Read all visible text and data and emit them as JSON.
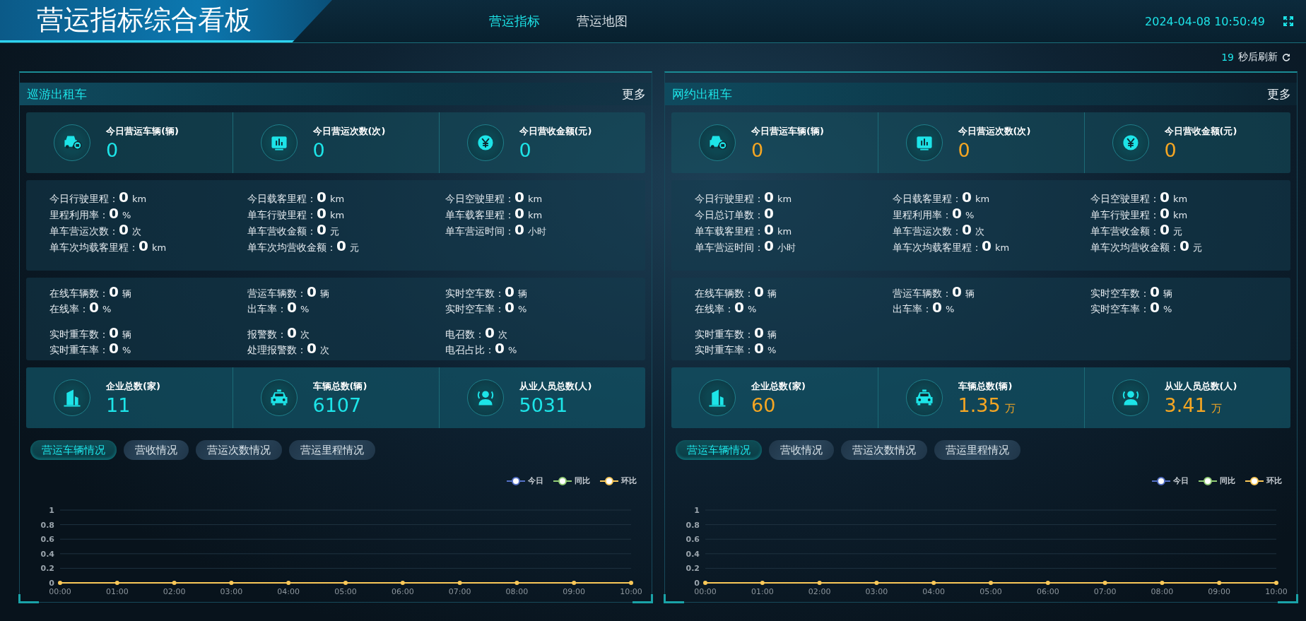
{
  "header": {
    "title": "营运指标综合看板",
    "nav": [
      {
        "label": "营运指标",
        "selected": true
      },
      {
        "label": "营运地图",
        "selected": false
      }
    ],
    "datetime": "2024-04-08 10:50:49"
  },
  "refresh": {
    "count": "19",
    "label": "秒后刷新"
  },
  "panels": [
    {
      "title": "巡游出租车",
      "more": "更多",
      "color": "#1de4e8",
      "kpis": [
        {
          "label": "今日营运车辆(辆)",
          "value": "0"
        },
        {
          "label": "今日营运次数(次)",
          "value": "0"
        },
        {
          "label": "今日营收金额(元)",
          "value": "0"
        }
      ],
      "mileage": [
        {
          "label": "今日行驶里程：",
          "value": "0",
          "unit": "km"
        },
        {
          "label": "今日载客里程：",
          "value": "0",
          "unit": "km"
        },
        {
          "label": "今日空驶里程：",
          "value": "0",
          "unit": "km"
        },
        {
          "label": "里程利用率：",
          "value": "0",
          "unit": "%"
        },
        {
          "label": "单车行驶里程：",
          "value": "0",
          "unit": "km"
        },
        {
          "label": "单车载客里程：",
          "value": "0",
          "unit": "km"
        },
        {
          "label": "单车营运次数：",
          "value": "0",
          "unit": "次"
        },
        {
          "label": "单车营收金额：",
          "value": "0",
          "unit": "元"
        },
        {
          "label": "单车营运时间：",
          "value": "0",
          "unit": "小时"
        },
        {
          "label": "单车次均载客里程：",
          "value": "0",
          "unit": "km"
        },
        {
          "label": "单车次均营收金额：",
          "value": "0",
          "unit": "元"
        }
      ],
      "realtime": [
        [
          [
            {
              "label": "在线车辆数：",
              "value": "0",
              "unit": "辆"
            },
            {
              "label": "在线率：",
              "value": "0",
              "unit": "%"
            }
          ],
          [
            {
              "label": "营运车辆数：",
              "value": "0",
              "unit": "辆"
            },
            {
              "label": "出车率：",
              "value": "0",
              "unit": "%"
            }
          ],
          [
            {
              "label": "实时空车数：",
              "value": "0",
              "unit": "辆"
            },
            {
              "label": "实时空车率：",
              "value": "0",
              "unit": "%"
            }
          ]
        ],
        [
          [
            {
              "label": "实时重车数：",
              "value": "0",
              "unit": "辆"
            },
            {
              "label": "实时重车率：",
              "value": "0",
              "unit": "%"
            }
          ],
          [
            {
              "label": "报警数：",
              "value": "0",
              "unit": "次"
            },
            {
              "label": "处理报警数：",
              "value": "0",
              "unit": "次"
            }
          ],
          [
            {
              "label": "电召数：",
              "value": "0",
              "unit": "次"
            },
            {
              "label": "电召占比：",
              "value": "0",
              "unit": "%"
            }
          ]
        ]
      ],
      "totals": [
        {
          "label": "企业总数(家)",
          "value": "11"
        },
        {
          "label": "车辆总数(辆)",
          "value": "6107"
        },
        {
          "label": "从业人员总数(人)",
          "value": "5031"
        }
      ],
      "tabs": [
        {
          "label": "营运车辆情况",
          "selected": true
        },
        {
          "label": "营收情况",
          "selected": false
        },
        {
          "label": "营运次数情况",
          "selected": false
        },
        {
          "label": "营运里程情况",
          "selected": false
        }
      ],
      "chart_data": {
        "type": "line",
        "grid": true,
        "categories": [
          "00:00",
          "01:00",
          "02:00",
          "03:00",
          "04:00",
          "05:00",
          "06:00",
          "07:00",
          "08:00",
          "09:00",
          "10:00"
        ],
        "ylim": [
          0,
          1
        ],
        "yticks": [
          0,
          0.2,
          0.4,
          0.6,
          0.8,
          1
        ],
        "series": [
          {
            "name": "今日",
            "color": "#5470c6",
            "values": [
              null,
              null,
              null,
              null,
              null,
              null,
              null,
              null,
              null,
              null,
              null
            ]
          },
          {
            "name": "同比",
            "color": "#91cc75",
            "values": [
              null,
              null,
              null,
              null,
              null,
              null,
              null,
              null,
              null,
              null,
              null
            ]
          },
          {
            "name": "环比",
            "color": "#fac858",
            "marker": true,
            "values": [
              0,
              0,
              0,
              0,
              0,
              0,
              0,
              0,
              0,
              0,
              0
            ]
          }
        ]
      }
    },
    {
      "title": "网约出租车",
      "more": "更多",
      "color": "#f5a623",
      "kpis": [
        {
          "label": "今日营运车辆(辆)",
          "value": "0"
        },
        {
          "label": "今日营运次数(次)",
          "value": "0"
        },
        {
          "label": "今日营收金额(元)",
          "value": "0"
        }
      ],
      "mileage": [
        {
          "label": "今日行驶里程：",
          "value": "0",
          "unit": "km"
        },
        {
          "label": "今日载客里程：",
          "value": "0",
          "unit": "km"
        },
        {
          "label": "今日空驶里程：",
          "value": "0",
          "unit": "km"
        },
        {
          "label": "今日总订单数：",
          "value": "0"
        },
        {
          "label": "里程利用率：",
          "value": "0",
          "unit": "%"
        },
        {
          "label": "单车行驶里程：",
          "value": "0",
          "unit": "km"
        },
        {
          "label": "单车载客里程：",
          "value": "0",
          "unit": "km"
        },
        {
          "label": "单车营运次数：",
          "value": "0",
          "unit": "次"
        },
        {
          "label": "单车营收金额：",
          "value": "0",
          "unit": "元"
        },
        {
          "label": "单车营运时间：",
          "value": "0",
          "unit": "小时"
        },
        {
          "label": "单车次均载客里程：",
          "value": "0",
          "unit": "km"
        },
        {
          "label": "单车次均营收金额：",
          "value": "0",
          "unit": "元"
        }
      ],
      "realtime": [
        [
          [
            {
              "label": "在线车辆数：",
              "value": "0",
              "unit": "辆"
            },
            {
              "label": "在线率：",
              "value": "0",
              "unit": "%"
            }
          ],
          [
            {
              "label": "营运车辆数：",
              "value": "0",
              "unit": "辆"
            },
            {
              "label": "出车率：",
              "value": "0",
              "unit": "%"
            }
          ],
          [
            {
              "label": "实时空车数：",
              "value": "0",
              "unit": "辆"
            },
            {
              "label": "实时空车率：",
              "value": "0",
              "unit": "%"
            }
          ]
        ],
        [
          [
            {
              "label": "实时重车数：",
              "value": "0",
              "unit": "辆"
            },
            {
              "label": "实时重车率：",
              "value": "0",
              "unit": "%"
            }
          ]
        ]
      ],
      "totals": [
        {
          "label": "企业总数(家)",
          "value": "60"
        },
        {
          "label": "车辆总数(辆)",
          "value": "1.35",
          "unit": "万"
        },
        {
          "label": "从业人员总数(人)",
          "value": "3.41",
          "unit": "万"
        }
      ],
      "tabs": [
        {
          "label": "营运车辆情况",
          "selected": true
        },
        {
          "label": "营收情况",
          "selected": false
        },
        {
          "label": "营运次数情况",
          "selected": false
        },
        {
          "label": "营运里程情况",
          "selected": false
        }
      ],
      "chart_data": {
        "type": "line",
        "grid": true,
        "categories": [
          "00:00",
          "01:00",
          "02:00",
          "03:00",
          "04:00",
          "05:00",
          "06:00",
          "07:00",
          "08:00",
          "09:00",
          "10:00"
        ],
        "ylim": [
          0,
          1
        ],
        "yticks": [
          0,
          0.2,
          0.4,
          0.6,
          0.8,
          1
        ],
        "series": [
          {
            "name": "今日",
            "color": "#5470c6",
            "values": [
              null,
              null,
              null,
              null,
              null,
              null,
              null,
              null,
              null,
              null,
              null
            ]
          },
          {
            "name": "同比",
            "color": "#91cc75",
            "values": [
              null,
              null,
              null,
              null,
              null,
              null,
              null,
              null,
              null,
              null,
              null
            ]
          },
          {
            "name": "环比",
            "color": "#fac858",
            "marker": true,
            "values": [
              0,
              0,
              0,
              0,
              0,
              0,
              0,
              0,
              0,
              0,
              0
            ]
          }
        ]
      }
    }
  ]
}
